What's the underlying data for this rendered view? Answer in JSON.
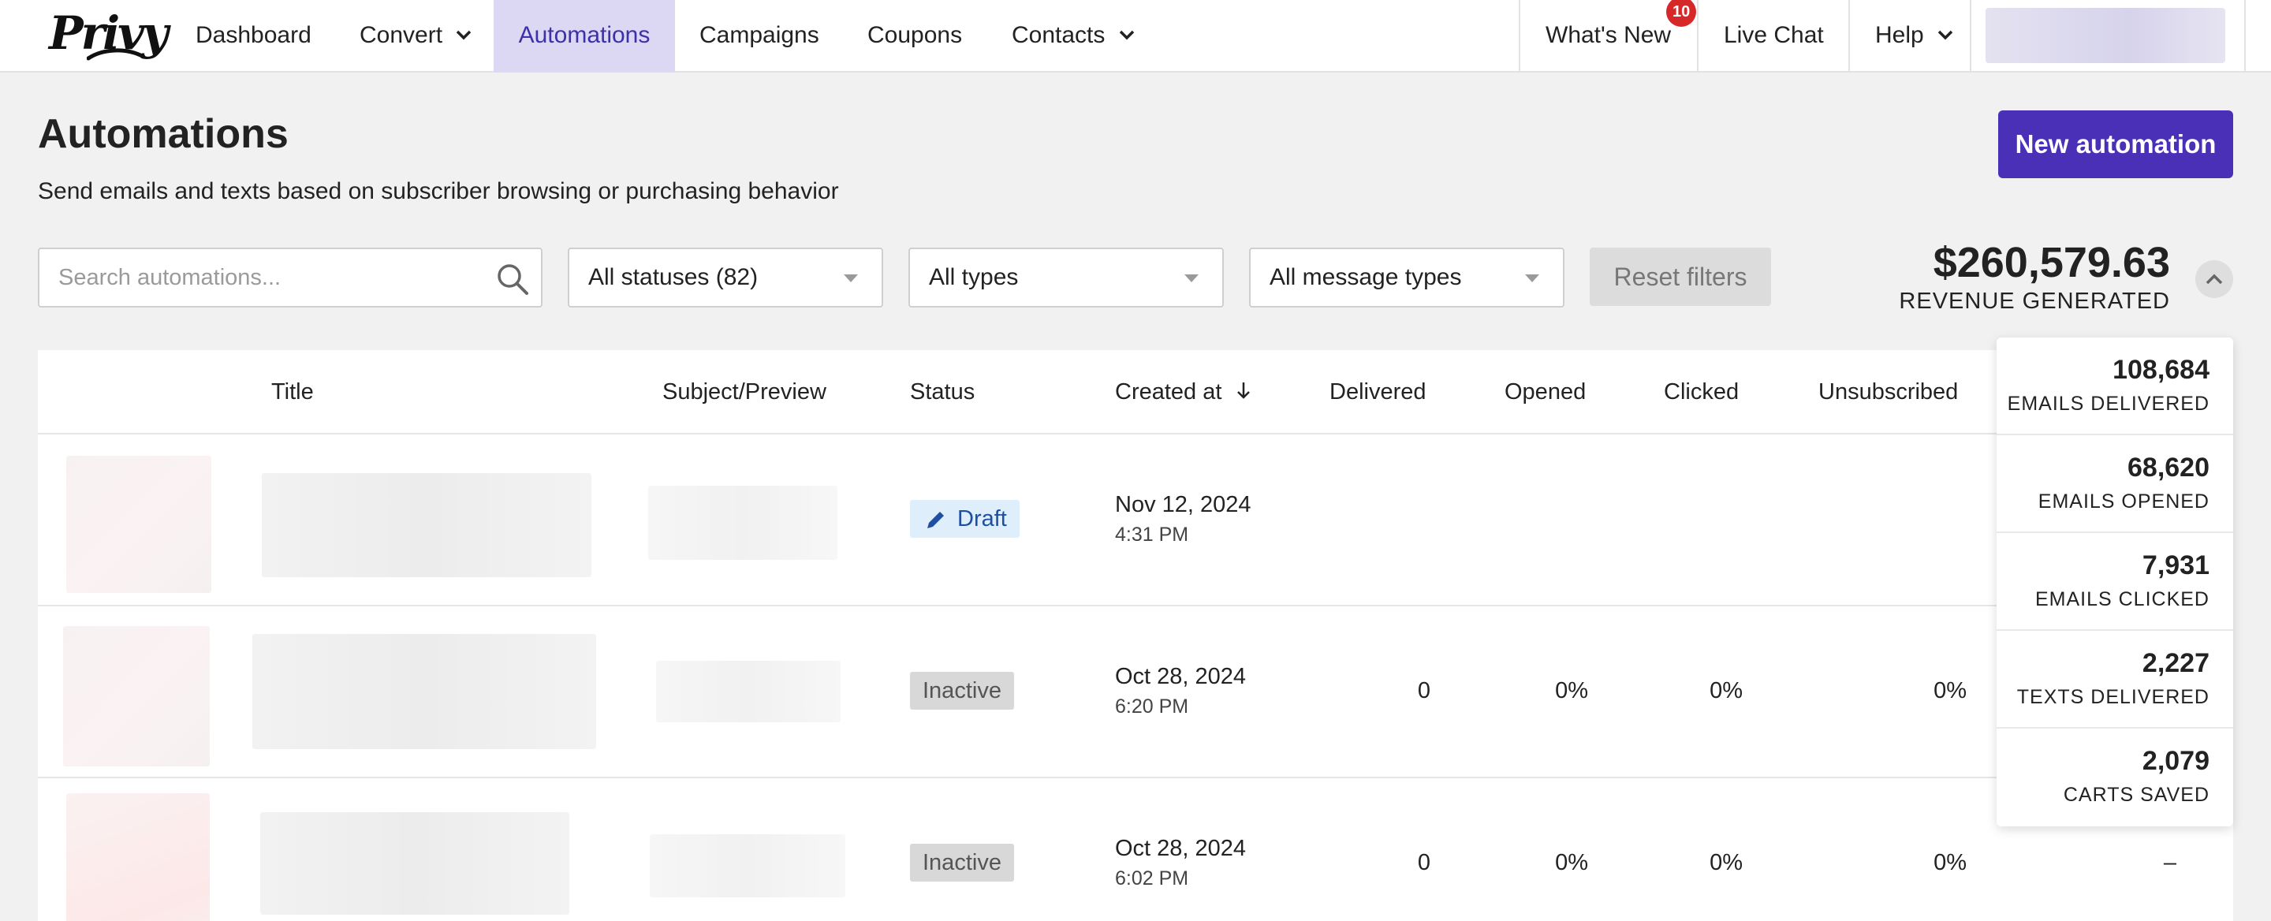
{
  "brand": {
    "logo_text": "Privy",
    "accent": "#4a30b6",
    "active_nav_bg": "#dcd8f3"
  },
  "nav": {
    "items": [
      {
        "label": "Dashboard"
      },
      {
        "label": "Convert",
        "dropdown": true
      },
      {
        "label": "Automations",
        "active": true
      },
      {
        "label": "Campaigns"
      },
      {
        "label": "Coupons"
      },
      {
        "label": "Contacts",
        "dropdown": true
      }
    ],
    "right": [
      {
        "label": "What's New",
        "badge": "10"
      },
      {
        "label": "Live Chat"
      },
      {
        "label": "Help",
        "dropdown": true
      }
    ]
  },
  "header": {
    "title": "Automations",
    "subtitle": "Send emails and texts based on subscriber browsing or purchasing behavior",
    "new_button": "New automation"
  },
  "filters": {
    "search_placeholder": "Search automations...",
    "status": "All statuses (82)",
    "type": "All types",
    "message_type": "All message types",
    "reset": "Reset filters"
  },
  "revenue": {
    "value": "$260,579.63",
    "label": "REVENUE GENERATED"
  },
  "table": {
    "columns": [
      "Title",
      "Subject/Preview",
      "Status",
      "Created at",
      "Delivered",
      "Opened",
      "Clicked",
      "Unsubscribed"
    ],
    "rows": [
      {
        "status": "Draft",
        "date": "Nov 12, 2024",
        "time": "4:31 PM",
        "delivered": "",
        "opened": "",
        "clicked": "",
        "unsubscribed": ""
      },
      {
        "status": "Inactive",
        "date": "Oct 28, 2024",
        "time": "6:20 PM",
        "delivered": "0",
        "opened": "0%",
        "clicked": "0%",
        "unsubscribed": "0%"
      },
      {
        "status": "Inactive",
        "date": "Oct 28, 2024",
        "time": "6:02 PM",
        "delivered": "0",
        "opened": "0%",
        "clicked": "0%",
        "unsubscribed": "0%",
        "extra": "–"
      }
    ]
  },
  "stats": [
    {
      "value": "108,684",
      "label": "EMAILS DELIVERED"
    },
    {
      "value": "68,620",
      "label": "EMAILS OPENED"
    },
    {
      "value": "7,931",
      "label": "EMAILS CLICKED"
    },
    {
      "value": "2,227",
      "label": "TEXTS DELIVERED"
    },
    {
      "value": "2,079",
      "label": "CARTS SAVED"
    }
  ]
}
